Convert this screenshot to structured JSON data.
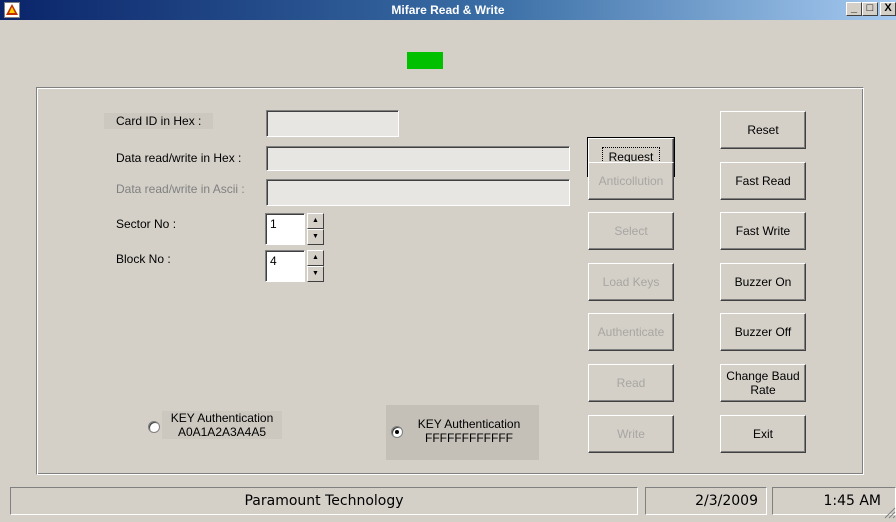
{
  "window": {
    "title": "Mifare Read & Write",
    "caption_buttons": {
      "minimize": "_",
      "maximize": "□",
      "close": "X"
    },
    "app_icon": "app-icon"
  },
  "status_indicator_color": "#00c000",
  "fields": {
    "card_id": {
      "label": "Card ID in Hex  :",
      "value": ""
    },
    "data_hex": {
      "label": "Data read/write in Hex  :",
      "value": ""
    },
    "data_ascii": {
      "label": "Data read/write in Ascii  :",
      "value": ""
    },
    "sector": {
      "label": "Sector No  :",
      "value": "1"
    },
    "block": {
      "label": "Block No  :",
      "value": "4"
    }
  },
  "spin_icons": {
    "up": "▲",
    "down": "▼"
  },
  "buttons_left": [
    {
      "label": "Request",
      "enabled": true
    },
    {
      "label": "Anticollution",
      "enabled": false
    },
    {
      "label": "Select",
      "enabled": false
    },
    {
      "label": "Load Keys",
      "enabled": false
    },
    {
      "label": "Authenticate",
      "enabled": false
    },
    {
      "label": "Read",
      "enabled": false
    },
    {
      "label": "Write",
      "enabled": false
    }
  ],
  "buttons_right": [
    {
      "label": "Reset"
    },
    {
      "label": "Fast Read"
    },
    {
      "label": "Fast Write"
    },
    {
      "label": "Buzzer On"
    },
    {
      "label": "Buzzer Off"
    },
    {
      "label": "Change Baud Rate"
    },
    {
      "label": "Exit"
    }
  ],
  "key_auth": [
    {
      "line1": "KEY Authentication",
      "line2": "A0A1A2A3A4A5",
      "selected": false
    },
    {
      "line1": "KEY Authentication",
      "line2": "FFFFFFFFFFFF",
      "selected": true
    }
  ],
  "statusbar": {
    "company": "Paramount Technology",
    "date": "2/3/2009",
    "time": "1:45 AM"
  }
}
